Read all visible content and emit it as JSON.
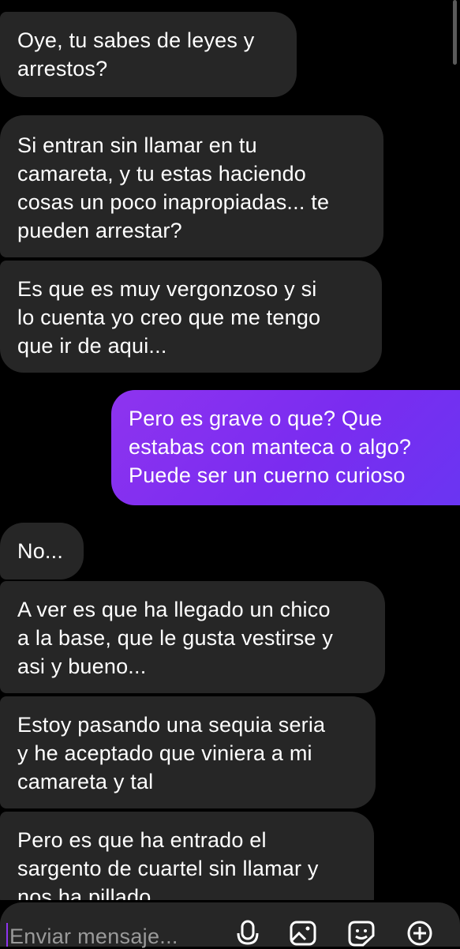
{
  "messages": [
    {
      "side": "received",
      "text": "Oye, tu sabes de leyes y\narrestos?"
    },
    {
      "side": "received",
      "text": "Si entran sin llamar en tu\ncamareta, y tu estas haciendo\ncosas un poco inapropiadas... te\npueden arrestar?"
    },
    {
      "side": "received",
      "text": "Es que es muy vergonzoso y si\nlo cuenta yo creo que me tengo\nque ir de aqui..."
    },
    {
      "side": "sent",
      "text": "Pero es grave o que? Que\nestabas con manteca o algo?\nPuede ser un cuerno curioso"
    },
    {
      "side": "received",
      "text": "No..."
    },
    {
      "side": "received",
      "text": "A ver es que ha llegado un chico\na la base, que le gusta vestirse y\nasi y bueno..."
    },
    {
      "side": "received",
      "text": "Estoy pasando una sequia seria\ny he aceptado que viniera a mi\ncamareta y tal"
    },
    {
      "side": "received",
      "text": "Pero es que ha entrado el\nsargento de cuartel sin llamar y\nnos ha pillado"
    }
  ],
  "composer": {
    "placeholder": "Enviar mensaje...",
    "icons": [
      "microphone-icon",
      "gallery-icon",
      "sticker-icon",
      "plus-icon"
    ],
    "accent_color": "#8e34ef"
  },
  "colors": {
    "received_bubble": "#262626",
    "sent_bubble": "#8e34ef",
    "background": "#000000"
  }
}
